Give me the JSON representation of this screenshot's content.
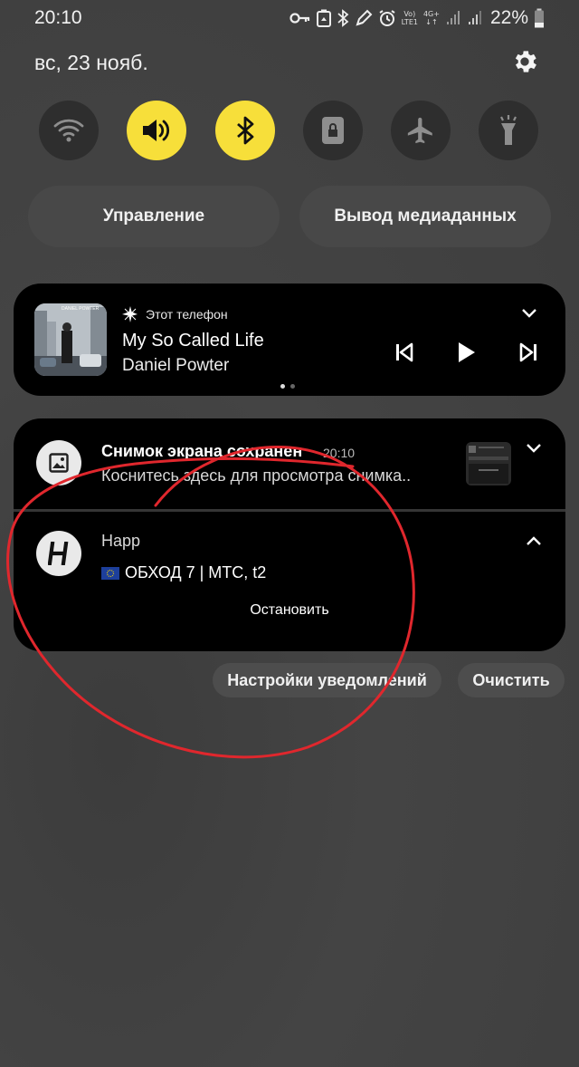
{
  "status_bar": {
    "time": "20:10",
    "volte": "Vo)",
    "lte": "LTE1",
    "network": "4G+",
    "battery": "22%",
    "icons": [
      "key-icon",
      "recycle-icon",
      "bluetooth-icon",
      "edit-icon",
      "alarm-icon",
      "volte-icon",
      "signal-icon",
      "battery-icon"
    ]
  },
  "header": {
    "date": "вс, 23 нояб.",
    "settings_icon": "gear-icon"
  },
  "quick_settings": [
    {
      "name": "wifi",
      "icon": "wifi-icon",
      "active": false
    },
    {
      "name": "sound",
      "icon": "speaker-icon",
      "active": true
    },
    {
      "name": "bluetooth",
      "icon": "bluetooth-icon",
      "active": true
    },
    {
      "name": "rotation-lock",
      "icon": "lock-icon",
      "active": false
    },
    {
      "name": "airplane",
      "icon": "airplane-icon",
      "active": false
    },
    {
      "name": "flashlight",
      "icon": "flashlight-icon",
      "active": false
    }
  ],
  "pills": {
    "control": "Управление",
    "media_output": "Вывод медиаданных"
  },
  "media": {
    "source": "Этот телефон",
    "title": "My So Called Life",
    "artist": "Daniel Powter",
    "album_label": "DANIEL POWTER",
    "page_index": 0,
    "page_count": 2
  },
  "notifications": {
    "screenshot": {
      "title": "Снимок экрана сохранен",
      "time": "20:10",
      "text": "Коснитесь здесь для просмотра снимка.."
    },
    "happ": {
      "app": "Happ",
      "text": "ОБХОД 7 | МТС, t2",
      "action": "Остановить"
    }
  },
  "footer": {
    "settings": "Настройки уведомлений",
    "clear": "Очистить"
  },
  "colors": {
    "accent": "#f7df3a",
    "annotation": "#e0272d",
    "card": "#000000"
  }
}
